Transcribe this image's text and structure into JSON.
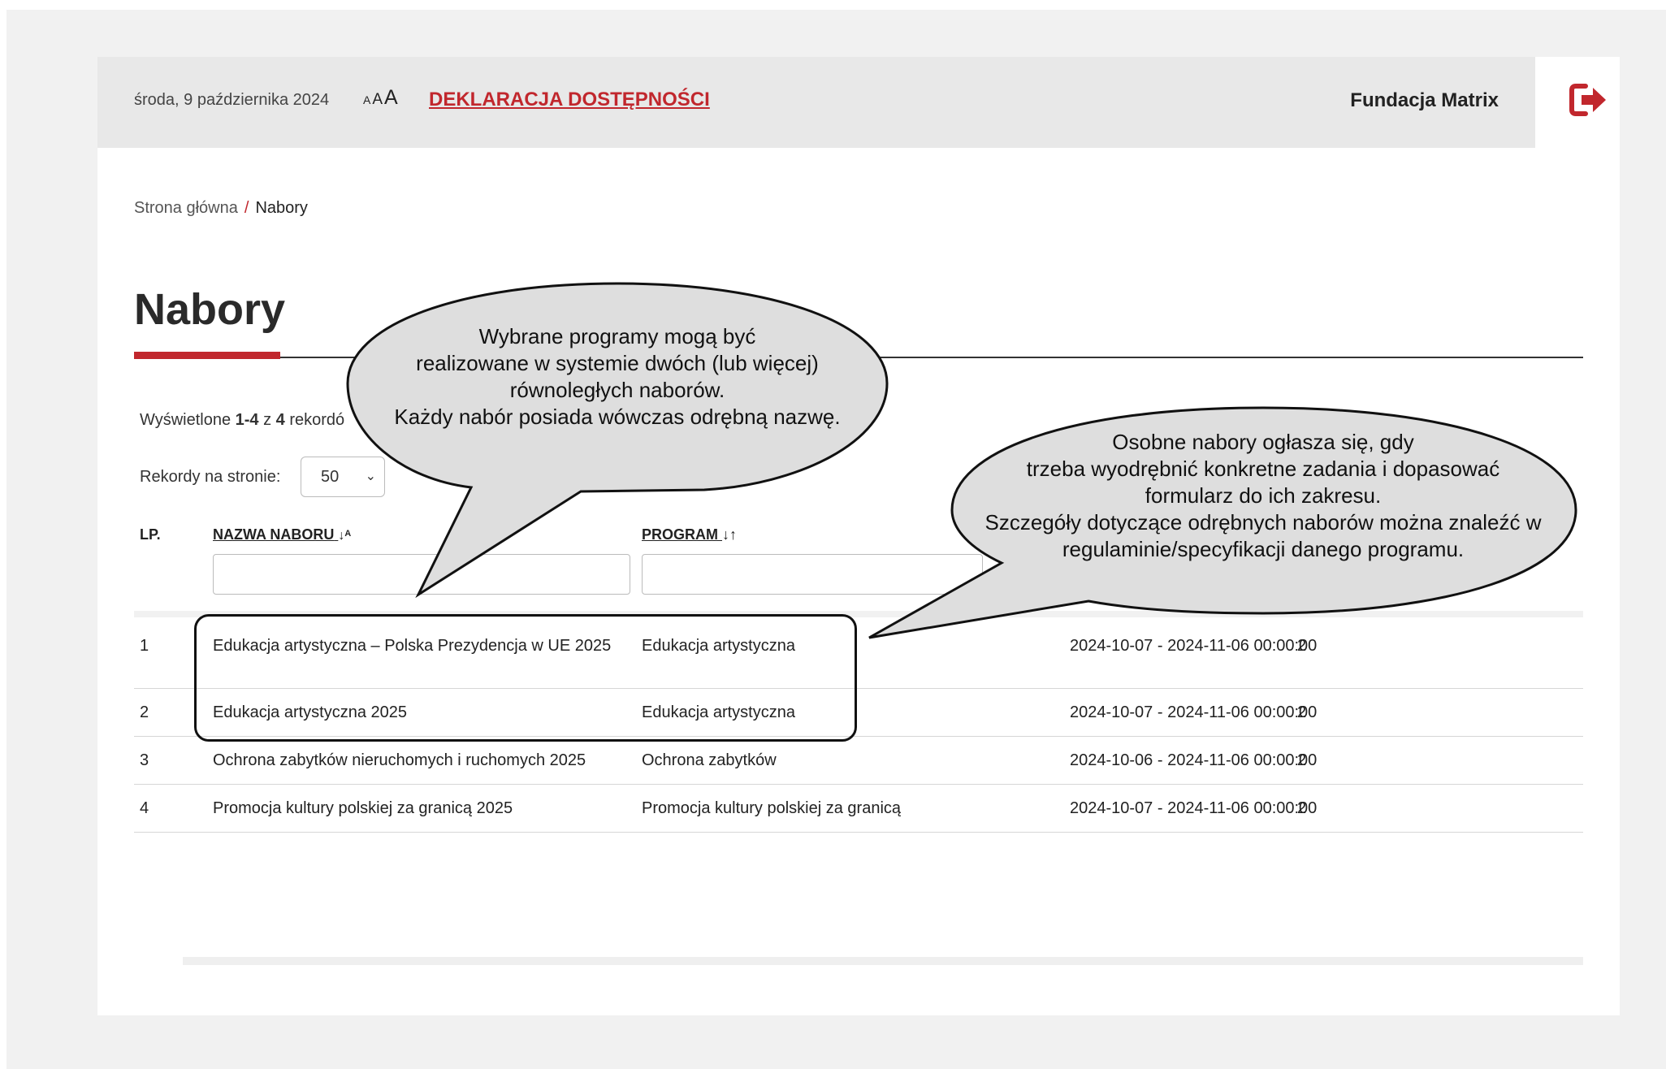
{
  "header": {
    "date": "środa, 9 października 2024",
    "font_sizes": [
      "A",
      "A",
      "A"
    ],
    "accessibility_link": "DEKLARACJA DOSTĘPNOŚCI",
    "organization": "Fundacja Matrix",
    "logout_icon": "logout-icon",
    "accent_color": "#c1272d"
  },
  "breadcrumb": {
    "home": "Strona główna",
    "separator": "/",
    "current": "Nabory"
  },
  "page_title": "Nabory",
  "records": {
    "prefix": "Wyświetlone ",
    "range": "1-4",
    "mid": " z ",
    "total": "4",
    "suffix": " rekordó"
  },
  "per_page": {
    "label": "Rekordy na stronie:",
    "value": "50"
  },
  "table": {
    "columns": {
      "lp": "LP.",
      "name": "NAZWA NABORU",
      "program": "PROGRAM"
    },
    "rows": [
      {
        "lp": "1",
        "name": "Edukacja artystyczna – Polska Prezydencja w UE 2025",
        "program": "Edukacja artystyczna",
        "dates": "2024-10-07 - 2024-11-06 00:00:00",
        "count": "2"
      },
      {
        "lp": "2",
        "name": "Edukacja artystyczna 2025",
        "program": "Edukacja artystyczna",
        "dates": "2024-10-07 - 2024-11-06 00:00:00",
        "count": "2"
      },
      {
        "lp": "3",
        "name": "Ochrona zabytków nieruchomych i ruchomych 2025",
        "program": "Ochrona zabytków",
        "dates": "2024-10-06 - 2024-11-06 00:00:00",
        "count": "2"
      },
      {
        "lp": "4",
        "name": "Promocja kultury polskiej za granicą 2025",
        "program": "Promocja kultury polskiej za granicą",
        "dates": "2024-10-07 - 2024-11-06 00:00:00",
        "count": "2"
      }
    ]
  },
  "callouts": {
    "left": [
      "Wybrane programy mogą być",
      "realizowane w systemie dwóch (lub więcej)",
      "równoległych naborów.",
      "Każdy nabór posiada wówczas odrębną nazwę."
    ],
    "right": [
      "Osobne nabory ogłasza się, gdy",
      "trzeba wyodrębnić konkretne zadania i dopasować",
      "formularz do ich zakresu.",
      "Szczegóły dotyczące odrębnych naborów można znaleźć w",
      "regulaminie/specyfikacji danego programu."
    ]
  }
}
